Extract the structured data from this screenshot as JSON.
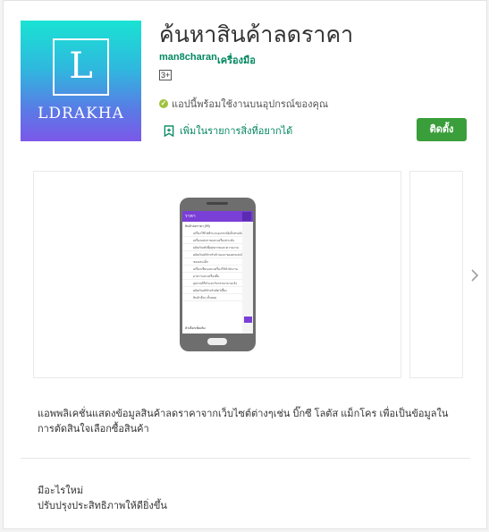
{
  "app": {
    "title": "ค้นหาสินค้าลดราคา",
    "developer": "man8charan",
    "category": "เครื่องมือ",
    "content_rating": "3+",
    "compatibility": "แอปนี้พร้อมใช้งานบนอุปกรณ์ของคุณ",
    "wishlist_label": "เพิ่มในรายการสิ่งที่อยากได้",
    "install_label": "ติดตั้ง",
    "icon": {
      "letter": "L",
      "brand_text": "LDRAKHA"
    }
  },
  "screenshot": {
    "bar_title": "ราคา",
    "group_label": "สินค้าลดราคา (99)",
    "rows": [
      "เครื่องใช้ไฟฟ้าและอุปกรณ์อิเล็กทรอนิกส์",
      "เครื่องแต่งกายและเครื่องประดับ",
      "ผลิตภัณฑ์เพื่อสุขภาพและความงาม",
      "ผลิตภัณฑ์สำหรับบ้านและของตกแต่งบ้าน",
      "ของเล่นเด็ก",
      "เครื่องเขียนและเครื่องใช้สำนักงาน",
      "อาหารและเครื่องดื่ม",
      "อุปกรณ์กีฬาและกิจกรรมกลางแจ้ง",
      "ผลิตภัณฑ์สำหรับสัตว์เลี้ยง",
      "สินค้าอื่นๆ ทั้งหมด"
    ],
    "footer_label": "ตัวเลือกเพิ่มเติม"
  },
  "description": "แอพพลิเคชั่นแสดงข้อมูลสินค้าลดราคาจากเว็บไซต์ต่างๆเช่น บิ๊กซี โลตัส แม็กโคร เพื่อเป็นข้อมูลในการตัดสินใจเลือกซื้อสินค้า",
  "whats_new": {
    "heading": "มีอะไรใหม่",
    "text": "ปรับปรุงประสิทธิภาพให้ดียิ่งขึ้น"
  },
  "colors": {
    "accent_green": "#01875f",
    "install_button": "#3a9e3a",
    "app_bar_purple": "#7a3fd6"
  },
  "icons": [
    "check-circle-icon",
    "bookmark-add-icon",
    "chevron-right-icon"
  ]
}
